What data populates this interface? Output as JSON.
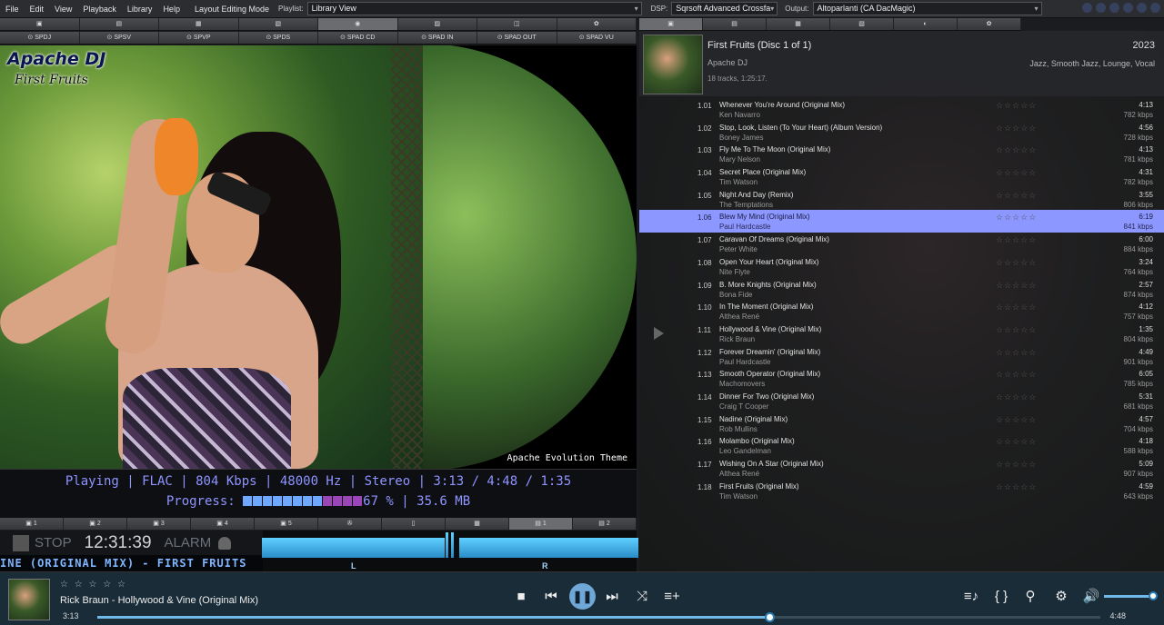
{
  "menubar": {
    "menus": [
      "File",
      "Edit",
      "View",
      "Playback",
      "Library",
      "Help",
      "Layout Editing Mode"
    ],
    "playlist_label": "Playlist:",
    "playlist_value": "Library View",
    "dsp_label": "DSP:",
    "dsp_value": "Sqrsoft Advanced Crossfa",
    "output_label": "Output:",
    "output_value": "Altoparlanti (CA DacMagic)"
  },
  "left_tabs": [
    "SPDJ",
    "SPSV",
    "SPVP",
    "SPDS",
    "SPAD CD",
    "SPAD IN",
    "SPAD OUT",
    "SPAD VU"
  ],
  "left_tabs_selected": 6,
  "artwork": {
    "album_artist": "Apache DJ",
    "album_title": "First Fruits",
    "theme_label": "Apache Evolution Theme"
  },
  "status": {
    "line1": "Playing | FLAC | 804 Kbps | 48000 Hz | Stereo | 3:13 / 4:48 / 1:35",
    "progress_label": "Progress:",
    "progress_value": "67 % | 35.6 MB",
    "progress_fraction": 0.67,
    "progress_segments": 12
  },
  "bottom_tabs": [
    "1",
    "2",
    "3",
    "4",
    "5",
    "",
    "",
    "",
    "1",
    "2"
  ],
  "bottom_tabs_selected": 8,
  "clock": {
    "stop_label": "STOP",
    "time": "12:31:39",
    "alarm_label": "ALARM"
  },
  "scroller_text": "INE (ORIGINAL MIX) - FIRST FRUITS",
  "vu": {
    "left_label": "L",
    "right_label": "R",
    "left_level": 0.49,
    "right_level": 0.48
  },
  "album": {
    "title": "First Fruits (Disc 1 of 1)",
    "artist": "Apache DJ",
    "tracks_info": "18 tracks, 1:25:17.",
    "year": "2023",
    "genres": "Jazz, Smooth Jazz, Lounge, Vocal"
  },
  "tracks": [
    {
      "num": "1.01",
      "title": "Whenever You're Around (Original Mix)",
      "artist": "Ken Navarro",
      "duration": "4:13",
      "bitrate": "782 kbps"
    },
    {
      "num": "1.02",
      "title": "Stop, Look, Listen (To Your Heart) (Album Version)",
      "artist": "Boney James",
      "duration": "4:56",
      "bitrate": "728 kbps"
    },
    {
      "num": "1.03",
      "title": "Fly Me To The Moon (Original Mix)",
      "artist": "Mary Nelson",
      "duration": "4:13",
      "bitrate": "781 kbps"
    },
    {
      "num": "1.04",
      "title": "Secret Place (Original Mix)",
      "artist": "Tim Watson",
      "duration": "4:31",
      "bitrate": "782 kbps"
    },
    {
      "num": "1.05",
      "title": "Night And Day (Remix)",
      "artist": "The Temptations",
      "duration": "3:55",
      "bitrate": "806 kbps"
    },
    {
      "num": "1.06",
      "title": "Blew My Mind (Original Mix)",
      "artist": "Paul Hardcastle",
      "duration": "6:19",
      "bitrate": "841 kbps"
    },
    {
      "num": "1.07",
      "title": "Caravan Of Dreams (Original Mix)",
      "artist": "Peter White",
      "duration": "6:00",
      "bitrate": "884 kbps"
    },
    {
      "num": "1.08",
      "title": "Open Your Heart (Original Mix)",
      "artist": "Nite Flyte",
      "duration": "3:24",
      "bitrate": "764 kbps"
    },
    {
      "num": "1.09",
      "title": "B. More Knights (Original Mix)",
      "artist": "Bona Fide",
      "duration": "2:57",
      "bitrate": "874 kbps"
    },
    {
      "num": "1.10",
      "title": "In The Moment (Original Mix)",
      "artist": "Althea René",
      "duration": "4:12",
      "bitrate": "757 kbps"
    },
    {
      "num": "1.11",
      "title": "Hollywood & Vine (Original Mix)",
      "artist": "Rick Braun",
      "duration": "1:35",
      "bitrate": "804 kbps"
    },
    {
      "num": "1.12",
      "title": "Forever Dreamin' (Original Mix)",
      "artist": "Paul Hardcastle",
      "duration": "4:49",
      "bitrate": "901 kbps"
    },
    {
      "num": "1.13",
      "title": "Smooth Operator (Original Mix)",
      "artist": "Machomovers",
      "duration": "6:05",
      "bitrate": "785 kbps"
    },
    {
      "num": "1.14",
      "title": "Dinner For Two (Original Mix)",
      "artist": "Craig T Cooper",
      "duration": "5:31",
      "bitrate": "681 kbps"
    },
    {
      "num": "1.15",
      "title": "Nadine (Original Mix)",
      "artist": "Rob Mullins",
      "duration": "4:57",
      "bitrate": "704 kbps"
    },
    {
      "num": "1.16",
      "title": "Molambo (Original Mix)",
      "artist": "Leo Gandelman",
      "duration": "4:18",
      "bitrate": "588 kbps"
    },
    {
      "num": "1.17",
      "title": "Wishing On A Star (Original Mix)",
      "artist": "Althea René",
      "duration": "5:09",
      "bitrate": "907 kbps"
    },
    {
      "num": "1.18",
      "title": "First Fruits (Original Mix)",
      "artist": "Tim Watson",
      "duration": "4:59",
      "bitrate": "643 kbps"
    }
  ],
  "selected_track": 5,
  "rating_glyphs": "☆☆☆☆☆",
  "footer": {
    "rating_glyphs": "☆ ☆ ☆ ☆ ☆",
    "now_playing": "Rick Braun - Hollywood & Vine (Original Mix)",
    "elapsed": "3:13",
    "total": "4:48",
    "seek_fraction": 0.67,
    "volume_fraction": 1.0
  },
  "colors": {
    "accent": "#8c98ff",
    "status_text": "#8f94ff",
    "seek": "#70b9e8"
  }
}
